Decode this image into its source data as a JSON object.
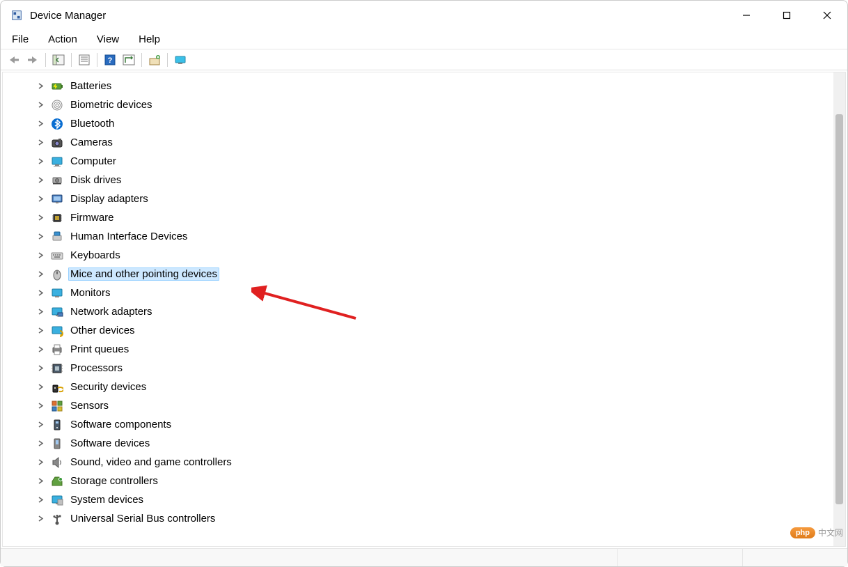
{
  "window": {
    "title": "Device Manager"
  },
  "menu": {
    "items": [
      "File",
      "Action",
      "View",
      "Help"
    ]
  },
  "tree": {
    "items": [
      {
        "id": "batteries",
        "label": "Batteries",
        "icon": "battery"
      },
      {
        "id": "biometric",
        "label": "Biometric devices",
        "icon": "fingerprint"
      },
      {
        "id": "bluetooth",
        "label": "Bluetooth",
        "icon": "bluetooth"
      },
      {
        "id": "cameras",
        "label": "Cameras",
        "icon": "camera"
      },
      {
        "id": "computer",
        "label": "Computer",
        "icon": "monitor"
      },
      {
        "id": "diskdrives",
        "label": "Disk drives",
        "icon": "disk"
      },
      {
        "id": "display",
        "label": "Display adapters",
        "icon": "display"
      },
      {
        "id": "firmware",
        "label": "Firmware",
        "icon": "chip"
      },
      {
        "id": "hid",
        "label": "Human Interface Devices",
        "icon": "hid"
      },
      {
        "id": "keyboards",
        "label": "Keyboards",
        "icon": "keyboard"
      },
      {
        "id": "mice",
        "label": "Mice and other pointing devices",
        "icon": "mouse",
        "selected": true
      },
      {
        "id": "monitors",
        "label": "Monitors",
        "icon": "monitor2"
      },
      {
        "id": "network",
        "label": "Network adapters",
        "icon": "network"
      },
      {
        "id": "other",
        "label": "Other devices",
        "icon": "other"
      },
      {
        "id": "print",
        "label": "Print queues",
        "icon": "printer"
      },
      {
        "id": "processors",
        "label": "Processors",
        "icon": "cpu"
      },
      {
        "id": "security",
        "label": "Security devices",
        "icon": "lock"
      },
      {
        "id": "sensors",
        "label": "Sensors",
        "icon": "sensor"
      },
      {
        "id": "swcomp",
        "label": "Software components",
        "icon": "swcomp"
      },
      {
        "id": "swdev",
        "label": "Software devices",
        "icon": "swdev"
      },
      {
        "id": "sound",
        "label": "Sound, video and game controllers",
        "icon": "speaker"
      },
      {
        "id": "storage",
        "label": "Storage controllers",
        "icon": "storage"
      },
      {
        "id": "system",
        "label": "System devices",
        "icon": "system"
      },
      {
        "id": "usb",
        "label": "Universal Serial Bus controllers",
        "icon": "usb"
      }
    ]
  },
  "watermark": {
    "badge": "php",
    "text": "中文网"
  }
}
